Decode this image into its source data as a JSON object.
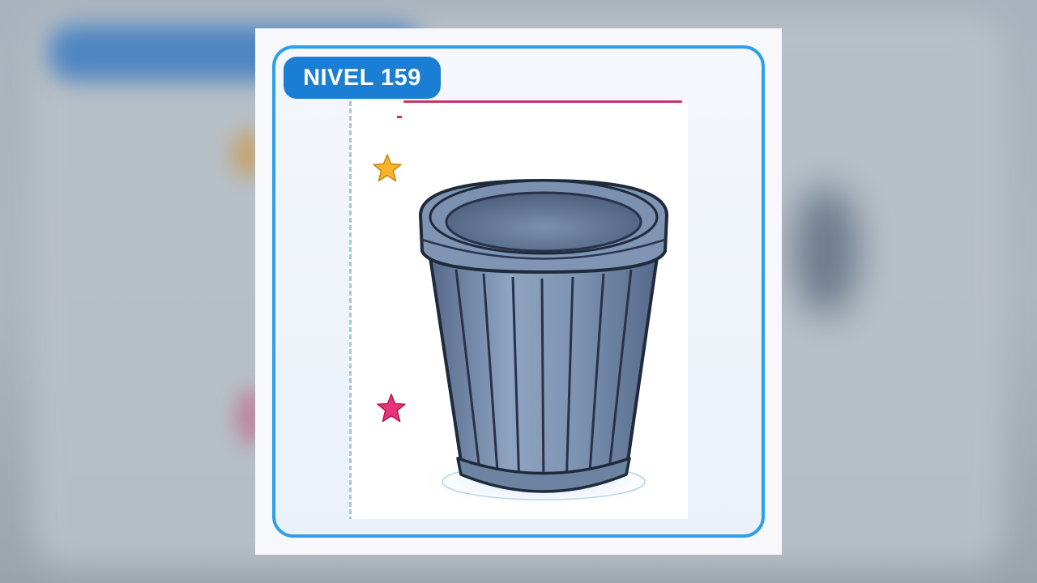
{
  "level": {
    "label": "NIVEL 159"
  },
  "colors": {
    "frame_border": "#2fa0e6",
    "badge_bg": "#1a7fd4",
    "star_yellow": "#f6b42a",
    "star_pink": "#e8337a",
    "bin_body": "#6f87a6",
    "bin_outline": "#1f2a3a"
  },
  "icons": {
    "star_top": "star-icon",
    "star_bottom": "star-icon",
    "object": "trash-bin-icon"
  }
}
